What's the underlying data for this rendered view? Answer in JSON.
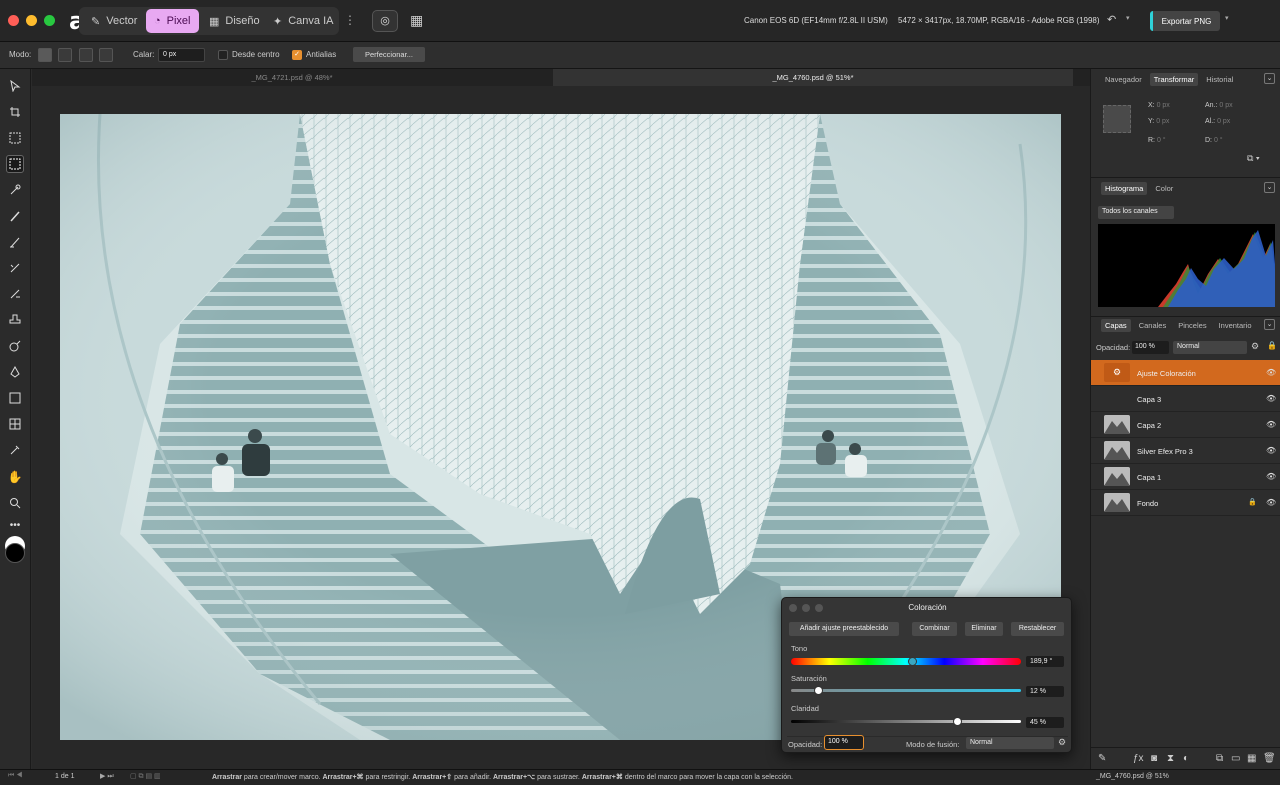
{
  "app": {
    "logo_glyph": "a"
  },
  "personas": [
    {
      "label": "Vector",
      "icon": "vector-icon"
    },
    {
      "label": "Pixel",
      "icon": "pixel-icon",
      "active": true
    },
    {
      "label": "Diseño",
      "icon": "layout-icon"
    },
    {
      "label": "Canva IA",
      "icon": "sparkle-icon"
    }
  ],
  "camera_info": "Canon EOS 6D (EF14mm f/2.8L II USM)",
  "image_info": "5472 × 3417px, 18.70MP, RGBA/16 - Adobe RGB (1998)",
  "export_label": "Exportar PNG",
  "context_toolbar": {
    "mode_label": "Modo:",
    "feather_label": "Calar:",
    "feather_value": "0 px",
    "from_center_label": "Desde centro",
    "antialias_label": "Antialias",
    "refine_label": "Perfeccionar..."
  },
  "doc_tabs": [
    {
      "label": "_MG_4721.psd @ 48%*",
      "active": false
    },
    {
      "label": "_MG_4760.psd @ 51%*",
      "active": true
    }
  ],
  "transform_panel": {
    "tabs": [
      "Navegador",
      "Transformar",
      "Historial"
    ],
    "active_tab": "Transformar",
    "x_label": "X:",
    "x_value": "0 px",
    "y_label": "Y:",
    "y_value": "0 px",
    "w_label": "An.:",
    "w_value": "0 px",
    "h_label": "Al.:",
    "h_value": "0 px",
    "r_label": "R:",
    "r_value": "0 °",
    "s_label": "D:",
    "s_value": "0 °"
  },
  "histogram_panel": {
    "tabs": [
      "Histograma",
      "Color"
    ],
    "active_tab": "Histograma",
    "channel_select": "Todos los canales"
  },
  "layers_panel": {
    "tabs": [
      "Capas",
      "Canales",
      "Pinceles",
      "Inventario"
    ],
    "active_tab": "Capas",
    "opacity_label": "Opacidad:",
    "opacity_value": "100 %",
    "blend_mode": "Normal",
    "layers": [
      {
        "name": "Ajuste Coloración",
        "selected": true,
        "kind": "adjustment"
      },
      {
        "name": "Capa 3",
        "kind": "empty"
      },
      {
        "name": "Capa 2",
        "kind": "photo"
      },
      {
        "name": "Silver Efex Pro 3",
        "kind": "photo"
      },
      {
        "name": "Capa 1",
        "kind": "photo"
      },
      {
        "name": "Fondo",
        "kind": "photo",
        "locked": true
      }
    ]
  },
  "colorize_dialog": {
    "title": "Coloración",
    "buttons": [
      "Añadir ajuste preestablecido",
      "Combinar",
      "Eliminar",
      "Restablecer"
    ],
    "hue": {
      "label": "Tono",
      "value": "189,9 °",
      "fraction": 0.527
    },
    "saturation": {
      "label": "Saturación",
      "value": "12 %",
      "fraction": 0.12
    },
    "lightness": {
      "label": "Claridad",
      "value": "45 %",
      "fraction": 0.725
    },
    "opacity_label": "Opacidad:",
    "opacity_value": "100 %",
    "blend_label": "Modo de fusión:",
    "blend_value": "Normal"
  },
  "status": {
    "page": "1 de 1",
    "hint_parts": [
      {
        "b": "Arrastrar",
        "t": " para crear/mover marco. "
      },
      {
        "b": "Arrastrar+⌘",
        "t": " para restringir. "
      },
      {
        "b": "Arrastrar+⇧",
        "t": " para añadir. "
      },
      {
        "b": "Arrastrar+⌥",
        "t": " para sustraer. "
      },
      {
        "b": "Arrastrar+⌘",
        "t": " dentro del marco para mover la capa con la selección."
      }
    ],
    "right_doc": "_MG_4760.psd @ 51%"
  },
  "colors": {
    "accent_orange": "#d2691e",
    "persona_pink": "#e8a9f2",
    "export_cyan": "#2fd2d9",
    "image_tint": "#8fb3b5"
  }
}
